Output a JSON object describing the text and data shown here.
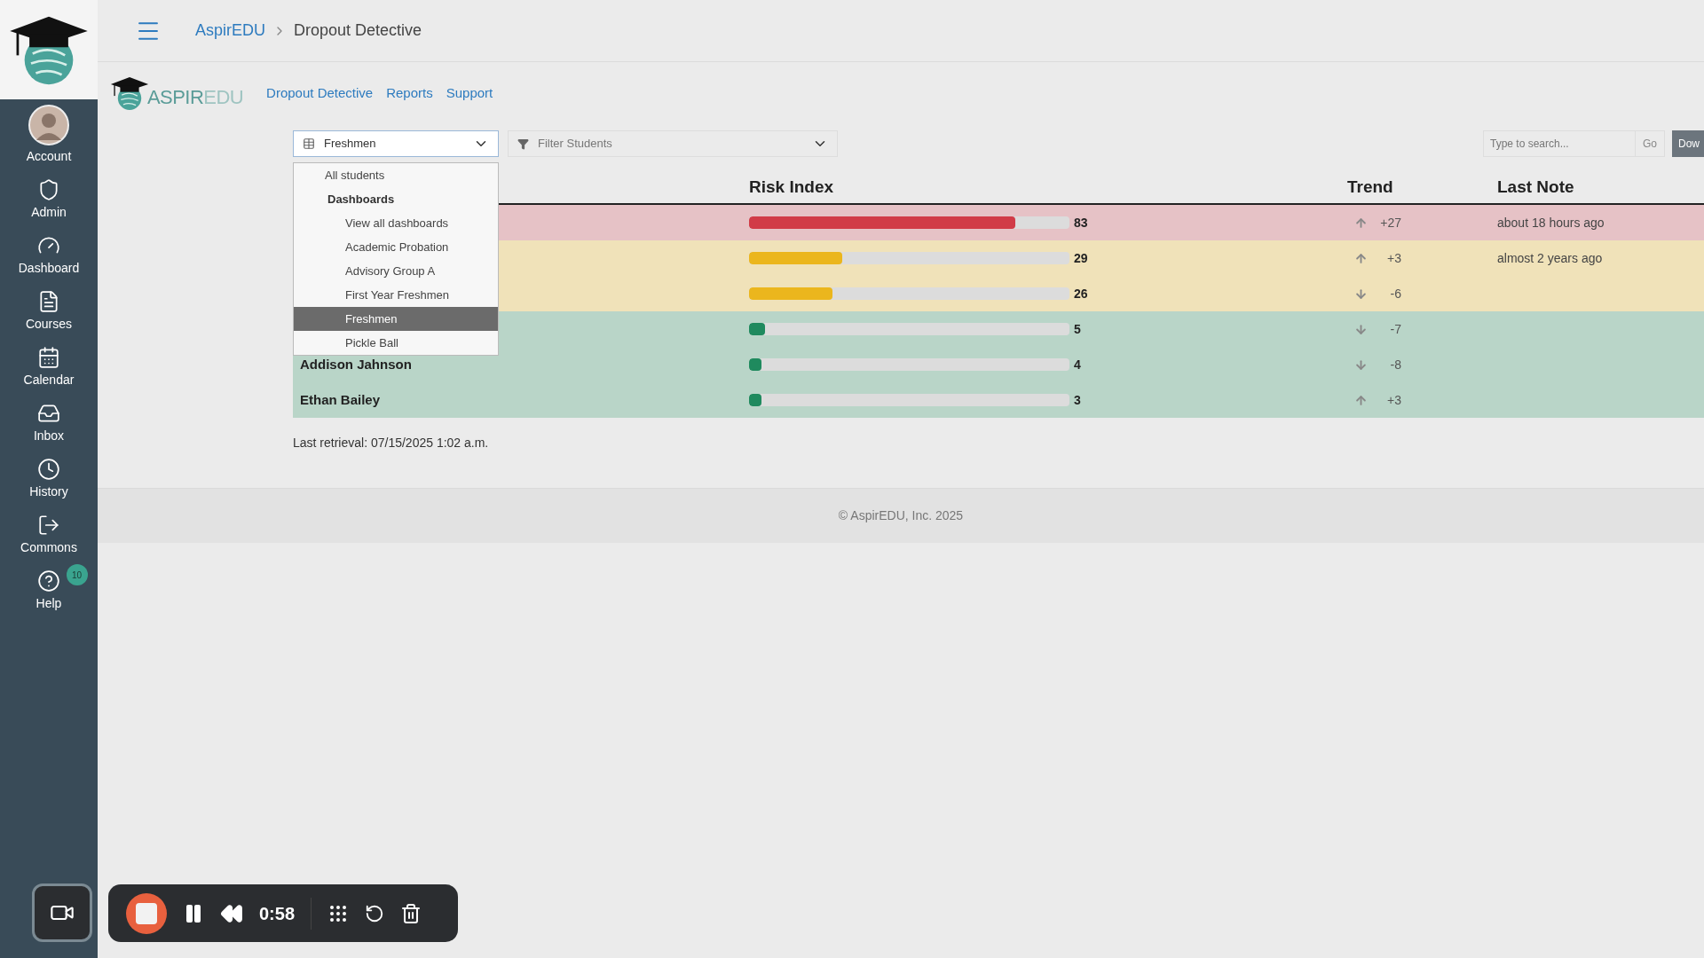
{
  "breadcrumb": [
    "AspirEDU",
    "Dropout Detective"
  ],
  "brand": {
    "logo_text": [
      "ASPIR",
      "EDU"
    ]
  },
  "sidebar": {
    "items": [
      {
        "label": "Account"
      },
      {
        "label": "Admin"
      },
      {
        "label": "Dashboard"
      },
      {
        "label": "Courses"
      },
      {
        "label": "Calendar"
      },
      {
        "label": "Inbox"
      },
      {
        "label": "History"
      },
      {
        "label": "Commons"
      },
      {
        "label": "Help",
        "badge": "10"
      }
    ]
  },
  "nav_links": [
    "Dropout Detective",
    "Reports",
    "Support"
  ],
  "dashboard_select": {
    "value": "Freshmen",
    "expanded": true,
    "options": [
      {
        "label": "All students",
        "kind": "option",
        "selected": false
      },
      {
        "label": "Dashboards",
        "kind": "header",
        "children": [
          {
            "label": "View all dashboards",
            "kind": "option",
            "selected": false
          },
          {
            "label": "Academic Probation",
            "kind": "option",
            "selected": false
          },
          {
            "label": "Advisory Group A",
            "kind": "option",
            "selected": false
          },
          {
            "label": "First Year Freshmen",
            "kind": "option",
            "selected": false
          },
          {
            "label": "Freshmen",
            "kind": "option",
            "selected": true
          },
          {
            "label": "Pickle Ball",
            "kind": "option",
            "selected": false
          }
        ]
      }
    ]
  },
  "filter": {
    "placeholder": "Filter Students"
  },
  "search": {
    "placeholder": "Type to search...",
    "button": "Go"
  },
  "download_button": "Dow",
  "table": {
    "columns": [
      "Risk Index",
      "Trend",
      "Last Note"
    ],
    "rows": [
      {
        "kind": "high",
        "level": 0.83,
        "score": "83",
        "rising": true,
        "trend": "+27",
        "note": "about 18 hours ago"
      },
      {
        "kind": "medium",
        "level": 0.29,
        "score": "29",
        "rising": true,
        "trend": "+3",
        "note": "almost 2 years ago"
      },
      {
        "kind": "medium",
        "level": 0.26,
        "score": "26",
        "rising": false,
        "trend": "-6"
      },
      {
        "kind": "low",
        "level": 0.05,
        "score": "5",
        "rising": false,
        "trend": "-7"
      },
      {
        "kind": "low",
        "level": 0.04,
        "score": "4",
        "rising": false,
        "trend": "-8",
        "name": "Addison Jahnson"
      },
      {
        "kind": "low",
        "level": 0.03,
        "score": "3",
        "rising": true,
        "trend": "+3",
        "name": "Ethan Bailey"
      }
    ]
  },
  "last_retrieval": "Last retrieval: 07/15/2025 1:02 a.m.",
  "footer": "© AspirEDU, Inc. 2025",
  "recorder": {
    "time": "0:58"
  }
}
